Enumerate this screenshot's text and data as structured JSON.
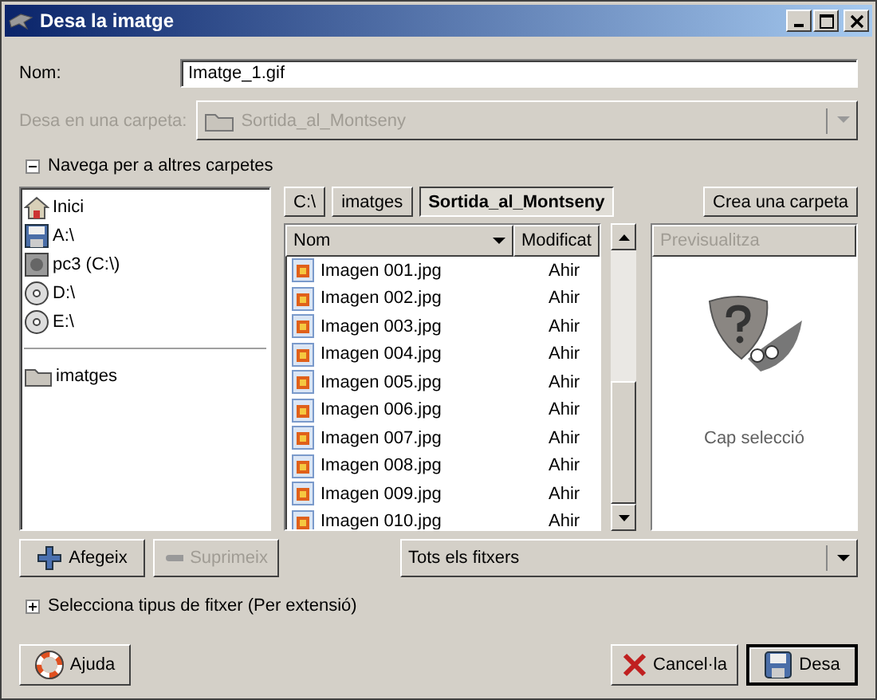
{
  "window": {
    "title": "Desa la imatge"
  },
  "name_field": {
    "label": "Nom:",
    "value": "Imatge_1.gif"
  },
  "folder_field": {
    "label": "Desa en una carpeta:",
    "value": "Sortida_al_Montseny",
    "disabled": true
  },
  "browse_expander": {
    "label": "Navega per a altres carpetes",
    "expanded": true
  },
  "places": [
    {
      "kind": "home",
      "label": "Inici"
    },
    {
      "kind": "floppy",
      "label": "A:\\"
    },
    {
      "kind": "harddisk",
      "label": "pc3 (C:\\)"
    },
    {
      "kind": "cdrom",
      "label": "D:\\"
    },
    {
      "kind": "cdrom",
      "label": "E:\\"
    }
  ],
  "bookmarks": [
    {
      "kind": "folder",
      "label": "imatges"
    }
  ],
  "path_buttons": [
    {
      "label": "C:\\",
      "selected": false
    },
    {
      "label": "imatges",
      "selected": false
    },
    {
      "label": "Sortida_al_Montseny",
      "selected": true
    }
  ],
  "create_folder_button": "Crea una carpeta",
  "file_table": {
    "columns": [
      {
        "label": "Nom",
        "sorted": true
      },
      {
        "label": "Modificat",
        "sorted": false
      }
    ],
    "rows": [
      {
        "name": "Imagen 001.jpg",
        "modified": "Ahir"
      },
      {
        "name": "Imagen 002.jpg",
        "modified": "Ahir"
      },
      {
        "name": "Imagen 003.jpg",
        "modified": "Ahir"
      },
      {
        "name": "Imagen 004.jpg",
        "modified": "Ahir"
      },
      {
        "name": "Imagen 005.jpg",
        "modified": "Ahir"
      },
      {
        "name": "Imagen 006.jpg",
        "modified": "Ahir"
      },
      {
        "name": "Imagen 007.jpg",
        "modified": "Ahir"
      },
      {
        "name": "Imagen 008.jpg",
        "modified": "Ahir"
      },
      {
        "name": "Imagen 009.jpg",
        "modified": "Ahir"
      },
      {
        "name": "Imagen 010.jpg",
        "modified": "Ahir"
      }
    ]
  },
  "preview": {
    "header": "Previsualitza",
    "header_disabled": true,
    "caption": "Cap selecció"
  },
  "add_button": {
    "label": "Afegeix",
    "disabled": false
  },
  "remove_button": {
    "label": "Suprimeix",
    "disabled": true
  },
  "filter_combo": {
    "value": "Tots els fitxers"
  },
  "filetype_expander": {
    "label": "Selecciona tipus de fitxer (Per extensió)",
    "expanded": false
  },
  "buttons": [
    {
      "kind": "help",
      "label": "Ajuda",
      "default": false
    },
    {
      "kind": "cancel",
      "label": "Cancel·la",
      "default": false
    },
    {
      "kind": "save",
      "label": "Desa",
      "default": true
    }
  ]
}
